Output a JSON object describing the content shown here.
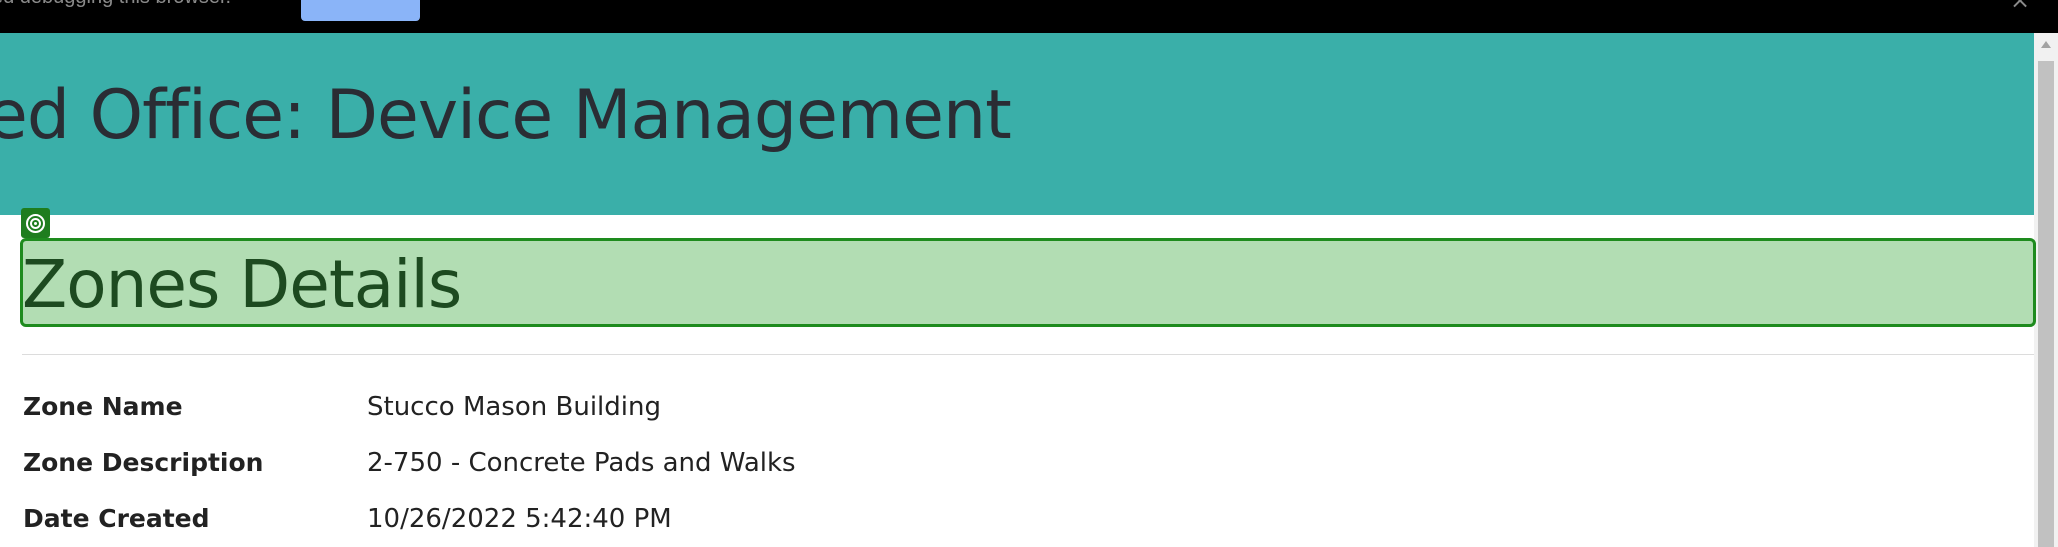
{
  "debug_banner": {
    "message": "ed debugging this browser.",
    "button_label": "",
    "close_glyph": "×"
  },
  "header": {
    "title": "ed Office: Device Management",
    "background_color": "#3aafa9"
  },
  "inspector": {
    "badge_icon": "target-icon",
    "highlight_color": "#b2ddb3",
    "border_color": "#1e8b1e"
  },
  "main": {
    "page_title": "Zones Details",
    "details": [
      {
        "label": "Zone Name",
        "value": "Stucco Mason Building"
      },
      {
        "label": "Zone Description",
        "value": "2-750 - Concrete Pads and Walks"
      },
      {
        "label": "Date Created",
        "value": "10/26/2022 5:42:40 PM"
      }
    ]
  }
}
